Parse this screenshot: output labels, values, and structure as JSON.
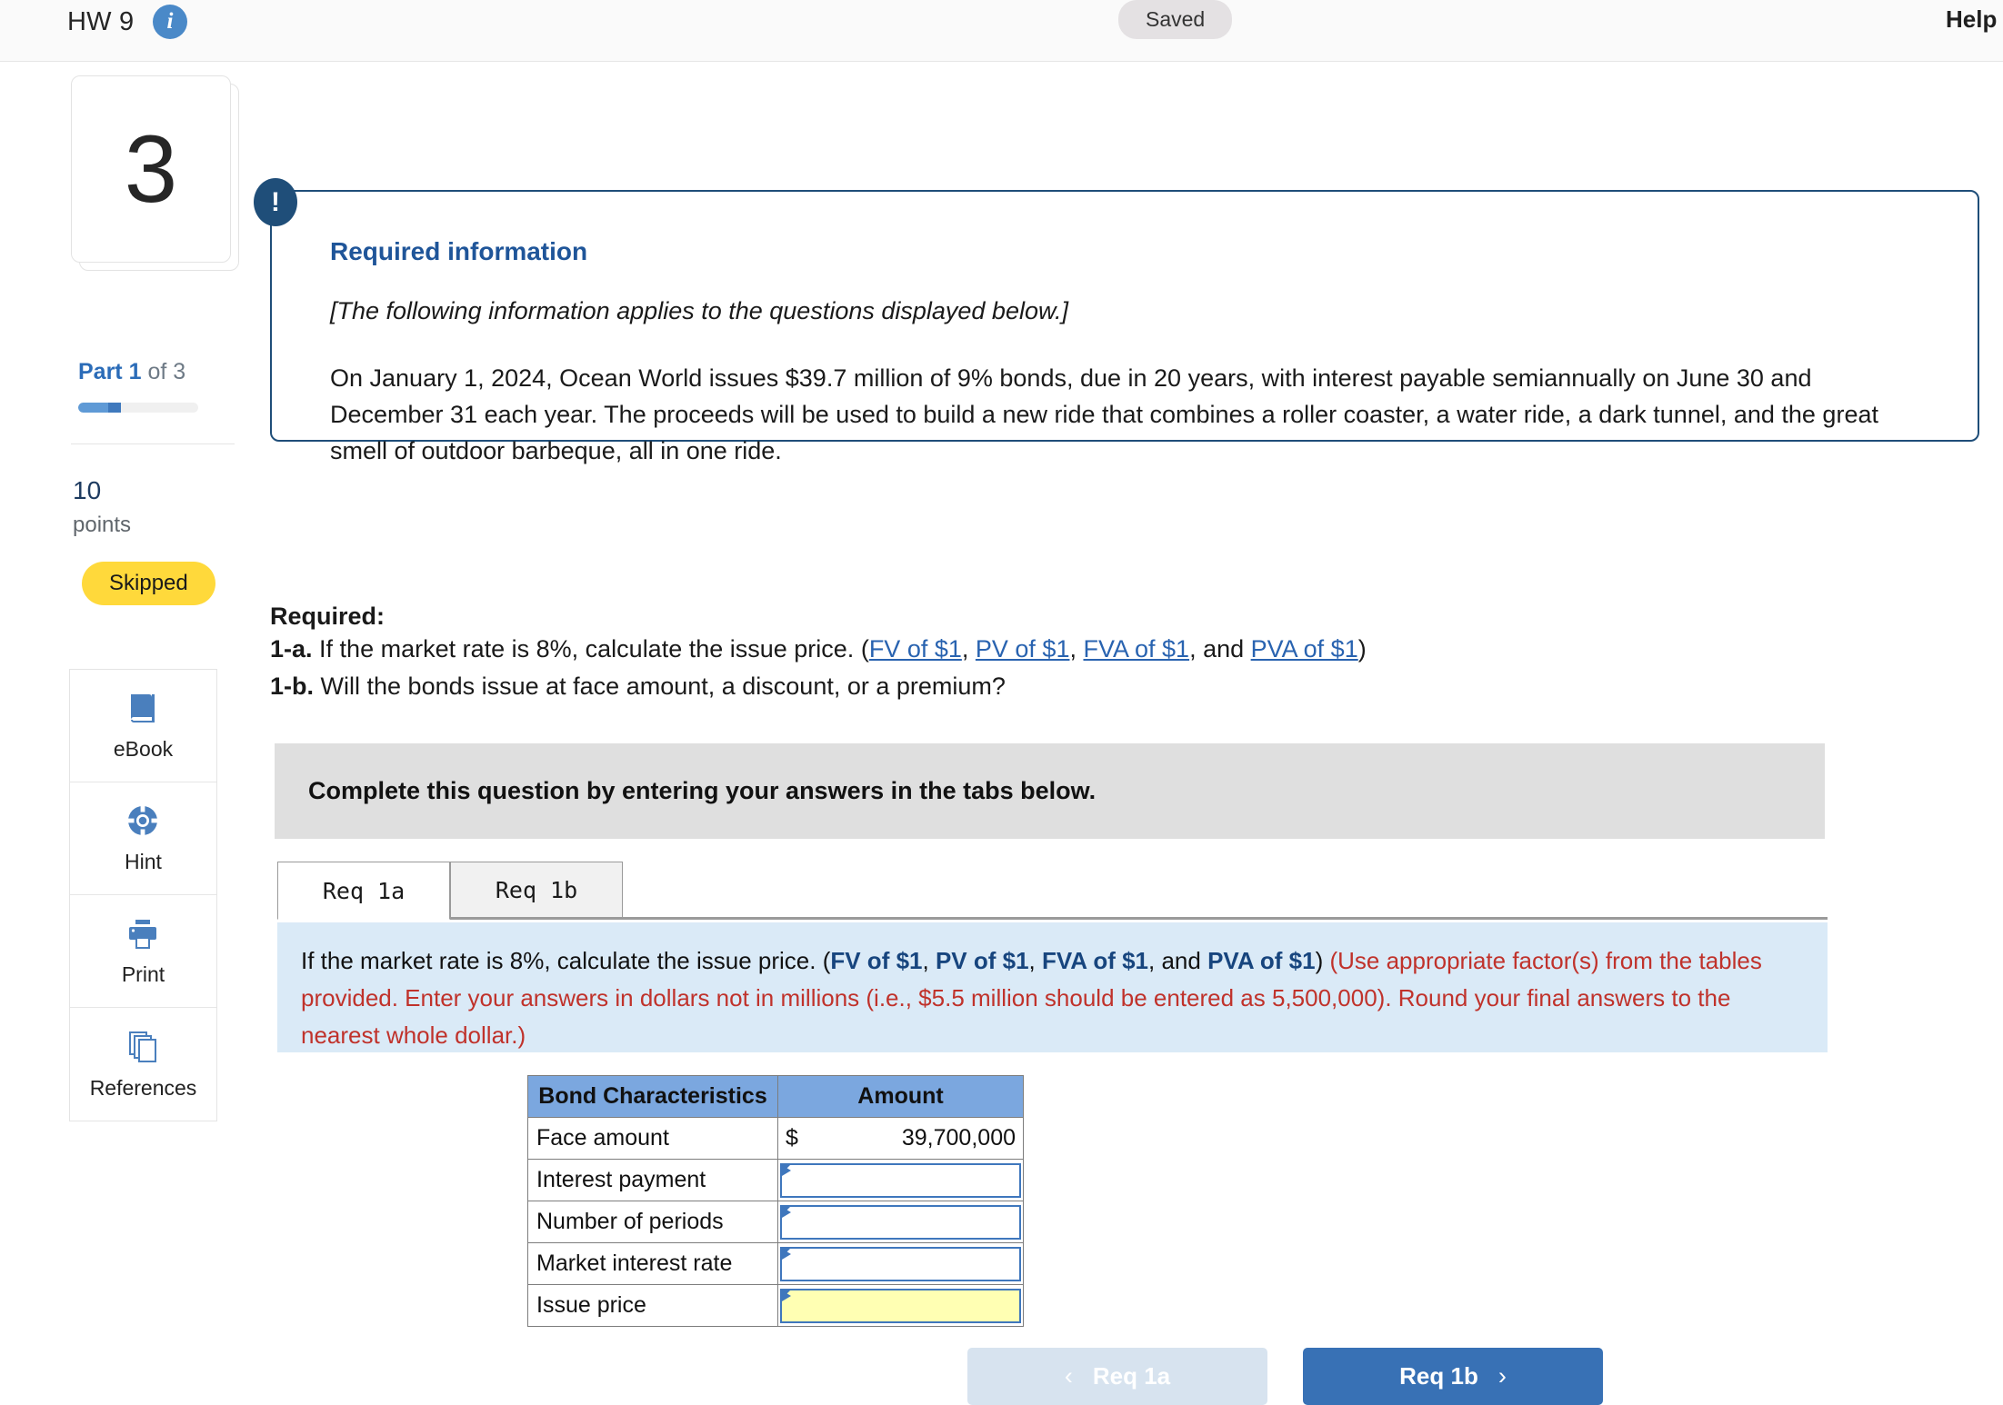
{
  "topbar": {
    "title": "HW 9",
    "info_icon": "info-circle-icon",
    "save_status": "Saved",
    "help_label": "Help"
  },
  "sidebar": {
    "question_number": "3",
    "part_prefix": "Part",
    "part_current": "1",
    "part_of": "of 3",
    "progress_percent": 35,
    "points_value": "10",
    "points_label": "points",
    "status_badge": "Skipped",
    "tools": [
      {
        "label": "eBook",
        "icon": "book-icon"
      },
      {
        "label": "Hint",
        "icon": "life-ring-icon"
      },
      {
        "label": "Print",
        "icon": "printer-icon"
      },
      {
        "label": "References",
        "icon": "stacked-pages-icon"
      }
    ]
  },
  "required_info": {
    "alert_icon": "exclamation-icon",
    "title": "Required information",
    "subtitle": "[The following information applies to the questions displayed below.]",
    "body": "On January 1, 2024, Ocean World issues $39.7 million of 9% bonds, due in 20 years, with interest payable semiannually on June 30 and December 31 each year. The proceeds will be used to build a new ride that combines a roller coaster, a water ride, a dark tunnel, and the great smell of outdoor barbeque, all in one ride."
  },
  "required": {
    "heading": "Required:",
    "item_1a_label": "1-a.",
    "item_1a_text": "If the market rate is 8%, calculate the issue price. (",
    "item_1a_links": [
      "FV of $1",
      "PV of $1",
      "FVA of $1",
      "PVA of $1"
    ],
    "item_1a_sep1": ", ",
    "item_1a_sep2": ", and ",
    "item_1a_tail": ")",
    "item_1b_label": "1-b.",
    "item_1b_text": "Will the bonds issue at face amount, a discount, or a premium?"
  },
  "instruction_bar": {
    "text": "Complete this question by entering your answers in the tabs below."
  },
  "tabs": [
    {
      "label": "Req 1a",
      "active": true
    },
    {
      "label": "Req 1b",
      "active": false
    }
  ],
  "blue_panel": {
    "lead": "If the market rate is 8%, calculate the issue price. (",
    "links": [
      "FV of $1",
      "PV of $1",
      "FVA of $1",
      "PVA of $1"
    ],
    "sep1": ", ",
    "sep2": ", and ",
    "close": ") ",
    "note": "(Use appropriate factor(s) from the tables provided. Enter your answers in dollars not in millions (i.e., $5.5 million should be entered as 5,500,000). Round your final answers to the nearest whole dollar.)"
  },
  "table": {
    "headers": [
      "Bond Characteristics",
      "Amount"
    ],
    "rows": [
      {
        "label": "Face amount",
        "type": "static",
        "currency": "$",
        "value": "39,700,000"
      },
      {
        "label": "Interest payment",
        "type": "input",
        "value": "",
        "highlight": false
      },
      {
        "label": "Number of periods",
        "type": "input",
        "value": "",
        "highlight": false
      },
      {
        "label": "Market interest rate",
        "type": "input",
        "value": "",
        "highlight": false
      },
      {
        "label": "Issue price",
        "type": "input",
        "value": "",
        "highlight": true
      }
    ]
  },
  "footer_nav": {
    "prev_label": "Req 1a",
    "prev_icon": "chevron-left-icon",
    "next_label": "Req 1b",
    "next_icon": "chevron-right-icon"
  },
  "colors": {
    "accent_blue": "#3871b5",
    "navy": "#1f4e79",
    "table_header": "#7ba7df",
    "input_border": "#3f77bd",
    "highlight_yellow": "#ffffb3",
    "panel_blue": "#daeaf7",
    "instruction_gray": "#dfdfdf",
    "skipped_yellow": "#ffd93b",
    "red_note": "#c0322b"
  }
}
